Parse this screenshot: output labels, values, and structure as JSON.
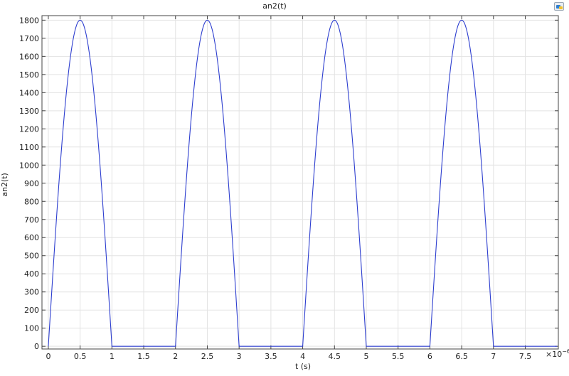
{
  "chart_data": {
    "type": "line",
    "title": "an2(t)",
    "xlabel": "t (s)",
    "ylabel": "an2(t)",
    "x_multiplier_base": "×10",
    "x_multiplier_exp": "−6",
    "xlim": [
      -0.1,
      8.02
    ],
    "ylim": [
      -15,
      1825
    ],
    "grid": true,
    "line_color": "#2d3ecf",
    "x_ticks": [
      0,
      0.5,
      1,
      1.5,
      2,
      2.5,
      3,
      3.5,
      4,
      4.5,
      5,
      5.5,
      6,
      6.5,
      7,
      7.5
    ],
    "x_tick_labels": [
      "0",
      "0.5",
      "1",
      "1.5",
      "2",
      "2.5",
      "3",
      "3.5",
      "4",
      "4.5",
      "5",
      "5.5",
      "6",
      "6.5",
      "7",
      "7.5"
    ],
    "y_ticks": [
      0,
      100,
      200,
      300,
      400,
      500,
      600,
      700,
      800,
      900,
      1000,
      1100,
      1200,
      1300,
      1400,
      1500,
      1600,
      1700,
      1800
    ],
    "y_tick_labels": [
      "0",
      "100",
      "200",
      "300",
      "400",
      "500",
      "600",
      "700",
      "800",
      "900",
      "1000",
      "1100",
      "1200",
      "1300",
      "1400",
      "1500",
      "1600",
      "1700",
      "1800"
    ],
    "series": [
      {
        "description": "half-wave rectified sine, amplitude 1800, period 2e-6 s",
        "x": [
          0,
          0.05,
          0.1,
          0.15,
          0.2,
          0.25,
          0.3,
          0.35,
          0.4,
          0.45,
          0.5,
          0.55,
          0.6,
          0.65,
          0.7,
          0.75,
          0.8,
          0.85,
          0.9,
          0.95,
          1,
          2,
          2.05,
          2.1,
          2.15,
          2.2,
          2.25,
          2.3,
          2.35,
          2.4,
          2.45,
          2.5,
          2.55,
          2.6,
          2.65,
          2.7,
          2.75,
          2.8,
          2.85,
          2.9,
          2.95,
          3,
          4,
          4.05,
          4.1,
          4.15,
          4.2,
          4.25,
          4.3,
          4.35,
          4.4,
          4.45,
          4.5,
          4.55,
          4.6,
          4.65,
          4.7,
          4.75,
          4.8,
          4.85,
          4.9,
          4.95,
          5,
          6,
          6.05,
          6.1,
          6.15,
          6.2,
          6.25,
          6.3,
          6.35,
          6.4,
          6.45,
          6.5,
          6.55,
          6.6,
          6.65,
          6.7,
          6.75,
          6.8,
          6.85,
          6.9,
          6.95,
          7,
          8
        ],
        "y": [
          0,
          282,
          556,
          817,
          1058,
          1273,
          1456,
          1604,
          1712,
          1778,
          1800,
          1778,
          1712,
          1604,
          1456,
          1273,
          1058,
          817,
          556,
          282,
          0,
          0,
          282,
          556,
          817,
          1058,
          1273,
          1456,
          1604,
          1712,
          1778,
          1800,
          1778,
          1712,
          1604,
          1456,
          1273,
          1058,
          817,
          556,
          282,
          0,
          0,
          282,
          556,
          817,
          1058,
          1273,
          1456,
          1604,
          1712,
          1778,
          1800,
          1778,
          1712,
          1604,
          1456,
          1273,
          1058,
          817,
          556,
          282,
          0,
          0,
          282,
          556,
          817,
          1058,
          1273,
          1456,
          1604,
          1712,
          1778,
          1800,
          1778,
          1712,
          1604,
          1456,
          1273,
          1058,
          817,
          556,
          282,
          0,
          0
        ]
      }
    ]
  }
}
